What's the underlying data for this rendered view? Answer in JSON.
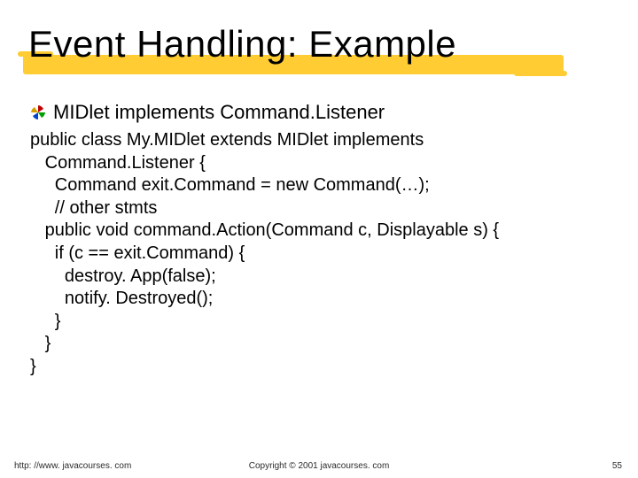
{
  "title": "Event Handling: Example",
  "subhead": "MIDlet implements Command.Listener",
  "code": "public class My.MIDlet extends MIDlet implements\n   Command.Listener {\n     Command exit.Command = new Command(…);\n     // other stmts\n   public void command.Action(Command c, Displayable s) {\n     if (c == exit.Command) {\n       destroy. App(false);\n       notify. Destroyed();\n     }\n   }\n}",
  "footer": {
    "left": "http: //www. javacourses. com",
    "center": "Copyright © 2001 javacourses. com",
    "page": "55"
  },
  "icon_name": "pinwheel-bullet-icon"
}
